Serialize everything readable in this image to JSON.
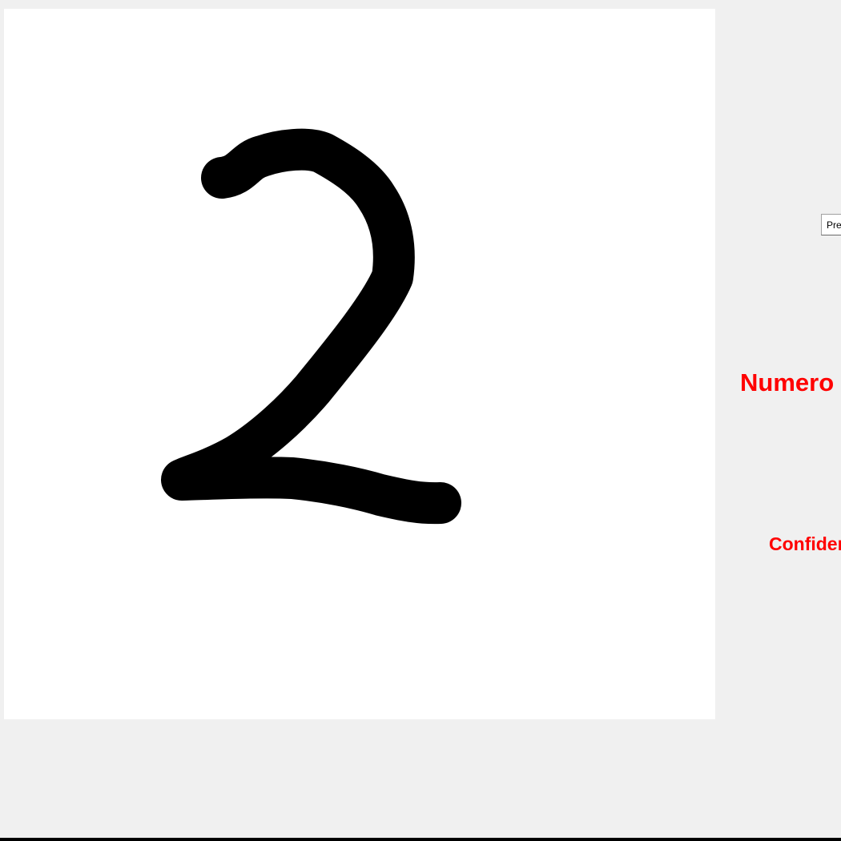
{
  "canvas": {
    "background": "#ffffff",
    "stroke_color": "#000000",
    "drawn_digit": "2"
  },
  "predict_button": {
    "label": "Predict"
  },
  "result": {
    "number_label": "Numero",
    "confidence_label": "Confidence",
    "label_color": "#ff0000"
  }
}
